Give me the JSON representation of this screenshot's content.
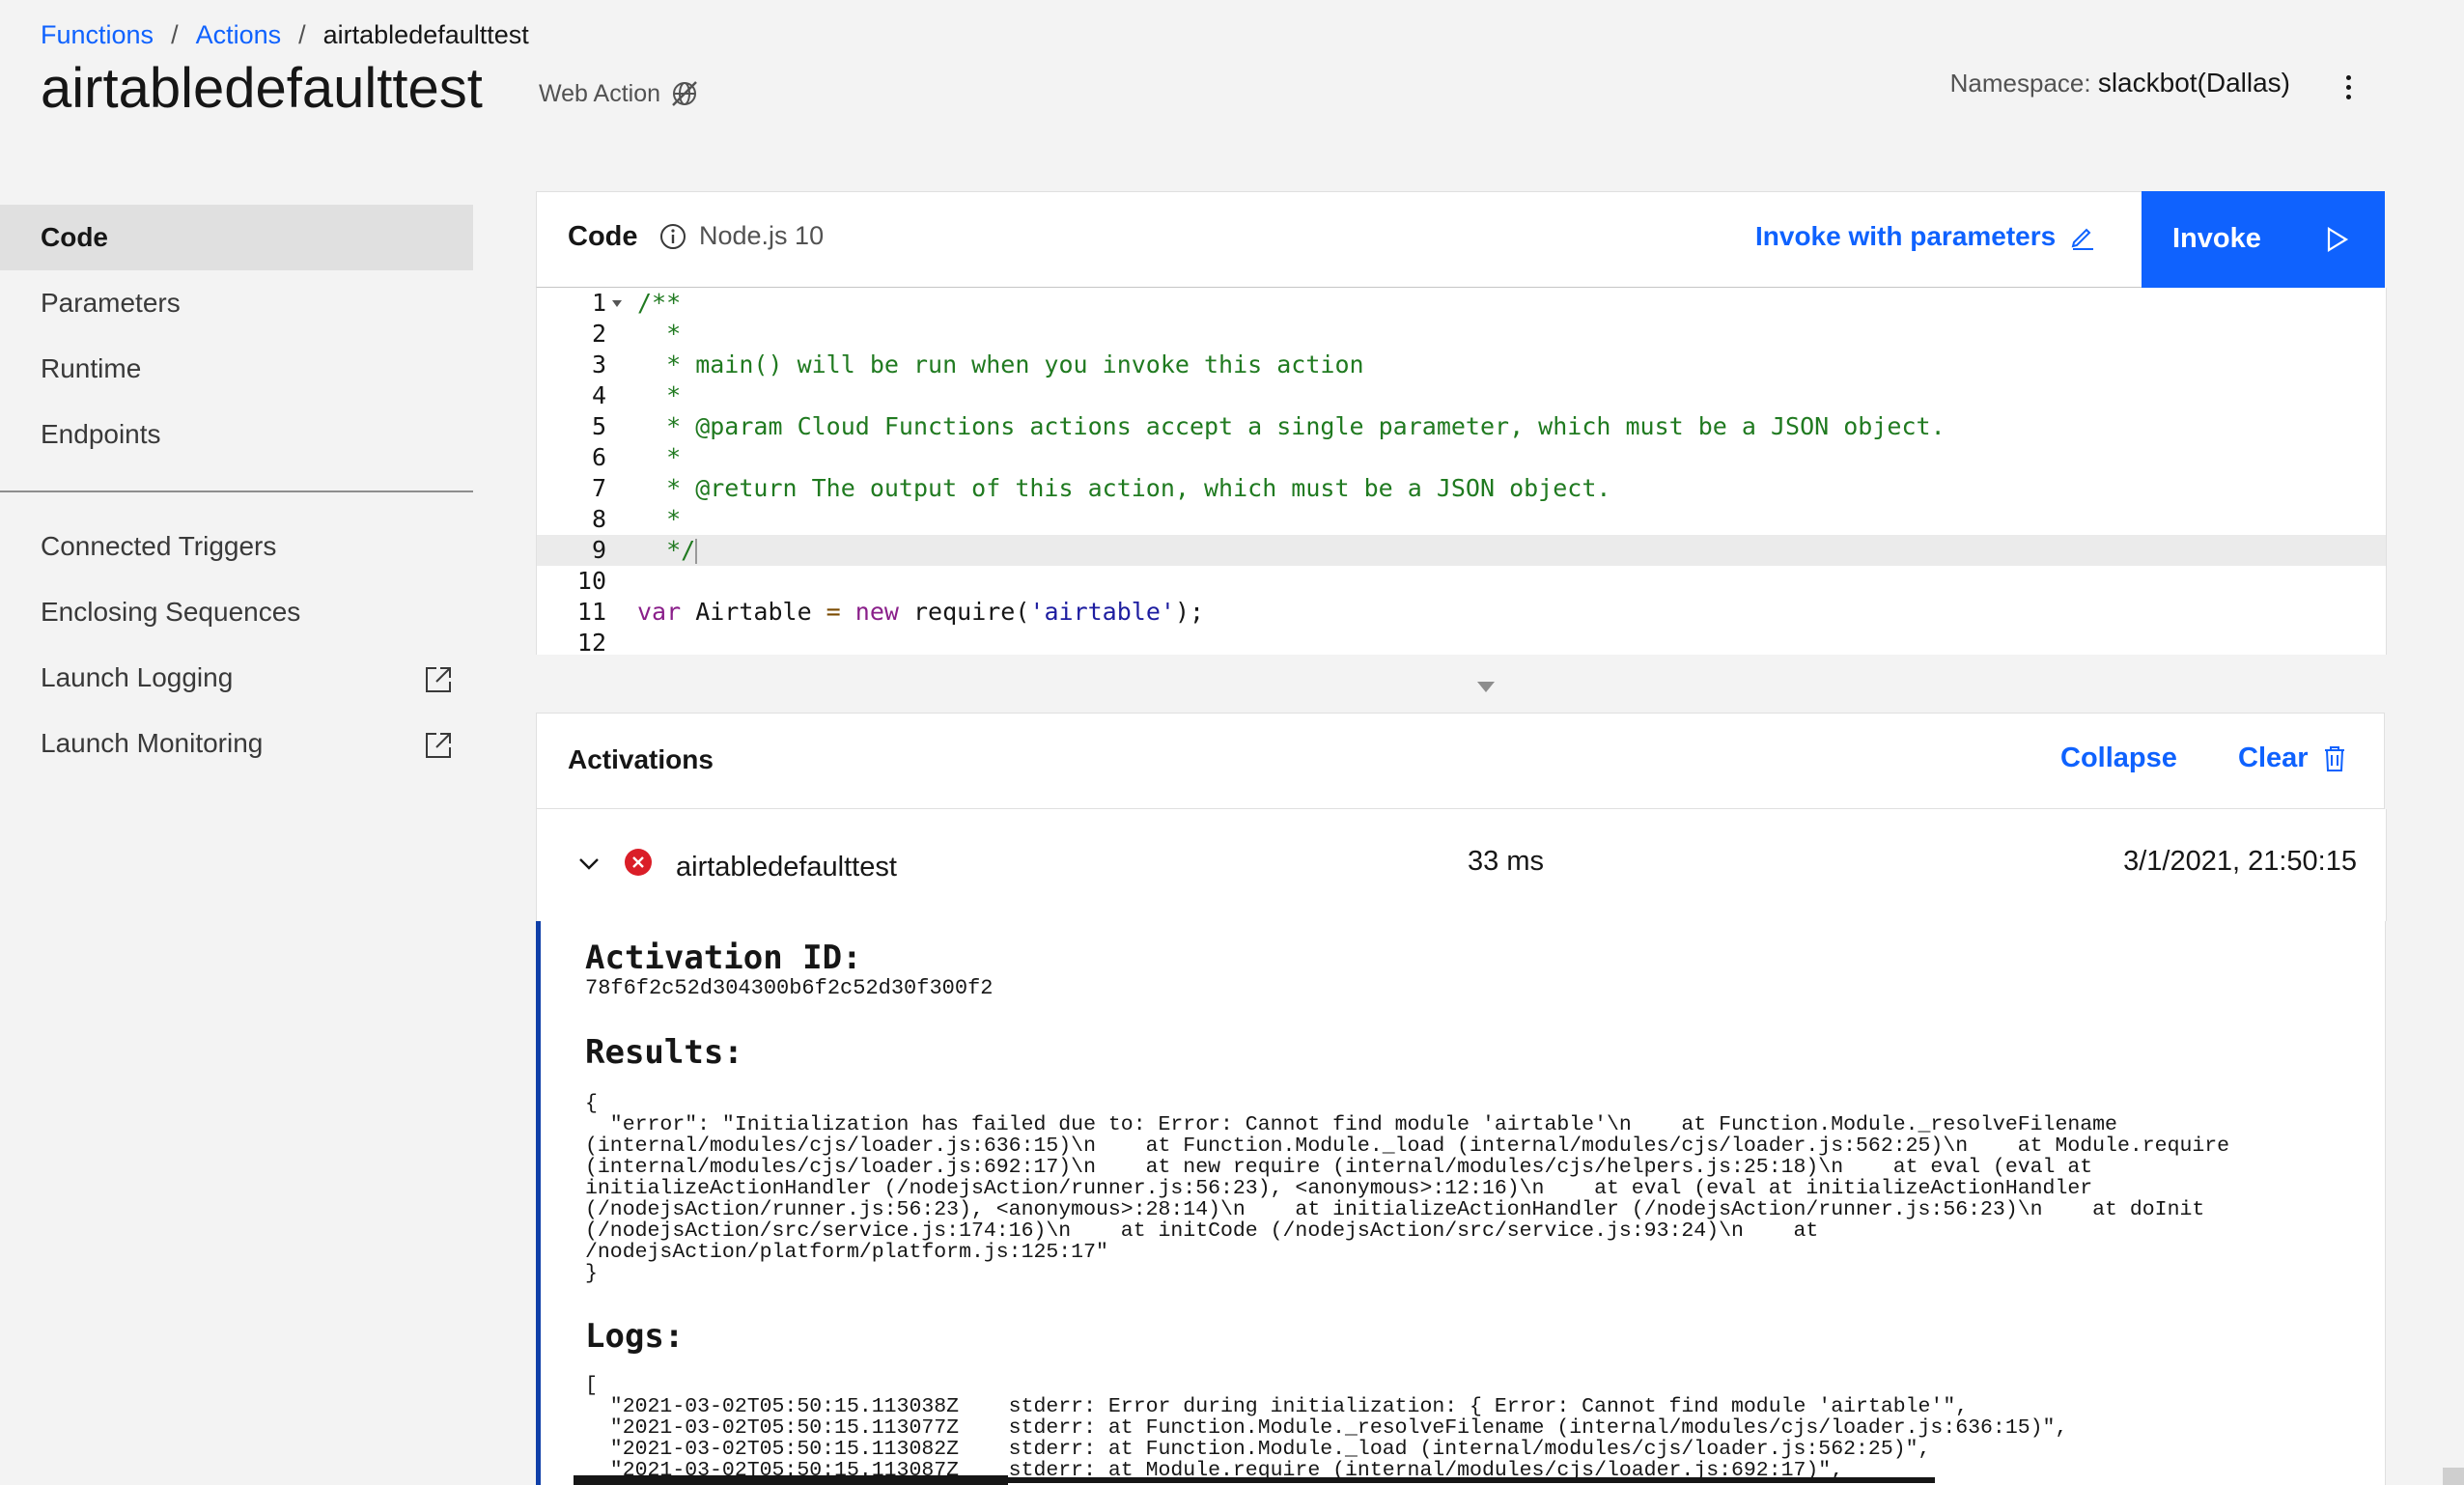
{
  "breadcrumb": {
    "functions": "Functions",
    "actions": "Actions",
    "current": "airtabledefaulttest"
  },
  "page_title": "airtabledefaulttest",
  "web_action_label": "Web Action",
  "namespace": {
    "label": "Namespace:",
    "value": "slackbot(Dallas)"
  },
  "sidebar": {
    "items": [
      {
        "label": "Code"
      },
      {
        "label": "Parameters"
      },
      {
        "label": "Runtime"
      },
      {
        "label": "Endpoints"
      },
      {
        "label": "Connected Triggers"
      },
      {
        "label": "Enclosing Sequences"
      },
      {
        "label": "Launch Logging"
      },
      {
        "label": "Launch Monitoring"
      }
    ]
  },
  "code_panel": {
    "title": "Code",
    "runtime": "Node.js 10",
    "invoke_with_params": "Invoke with parameters",
    "invoke": "Invoke"
  },
  "editor": {
    "lines": [
      {
        "n": "1",
        "text": "/**"
      },
      {
        "n": "2",
        "text": "  *"
      },
      {
        "n": "3",
        "text": "  * main() will be run when you invoke this action"
      },
      {
        "n": "4",
        "text": "  *"
      },
      {
        "n": "5",
        "text": "  * @param Cloud Functions actions accept a single parameter, which must be a JSON object."
      },
      {
        "n": "6",
        "text": "  *"
      },
      {
        "n": "7",
        "text": "  * @return The output of this action, which must be a JSON object."
      },
      {
        "n": "8",
        "text": "  *"
      },
      {
        "n": "9",
        "text": "  */"
      },
      {
        "n": "10",
        "text": ""
      },
      {
        "n": "11",
        "text": "var Airtable = new require('airtable');"
      },
      {
        "n": "12",
        "text": ""
      }
    ],
    "line11": {
      "kw_var": "var",
      "ident": " Airtable ",
      "eq": "=",
      "kw_new": " new",
      "call": " require(",
      "str": "'airtable'",
      "end": ");"
    }
  },
  "activations": {
    "title": "Activations",
    "collapse": "Collapse",
    "clear": "Clear",
    "row": {
      "name": "airtabledefaulttest",
      "duration": "33 ms",
      "date": "3/1/2021, 21:50:15",
      "status": "error"
    },
    "detail": {
      "id_heading": "Activation ID:",
      "id_value": "78f6f2c52d304300b6f2c52d30f300f2",
      "results_heading": "Results:",
      "results_text": "{\n  \"error\": \"Initialization has failed due to: Error: Cannot find module 'airtable'\\n    at Function.Module._resolveFilename\n(internal/modules/cjs/loader.js:636:15)\\n    at Function.Module._load (internal/modules/cjs/loader.js:562:25)\\n    at Module.require\n(internal/modules/cjs/loader.js:692:17)\\n    at new require (internal/modules/cjs/helpers.js:25:18)\\n    at eval (eval at\ninitializeActionHandler (/nodejsAction/runner.js:56:23), <anonymous>:12:16)\\n    at eval (eval at initializeActionHandler\n(/nodejsAction/runner.js:56:23), <anonymous>:28:14)\\n    at initializeActionHandler (/nodejsAction/runner.js:56:23)\\n    at doInit\n(/nodejsAction/src/service.js:174:16)\\n    at initCode (/nodejsAction/src/service.js:93:24)\\n    at\n/nodejsAction/platform/platform.js:125:17\"\n}",
      "logs_heading": "Logs:",
      "logs_text": "[\n  \"2021-03-02T05:50:15.113038Z    stderr: Error during initialization: { Error: Cannot find module 'airtable'\",\n  \"2021-03-02T05:50:15.113077Z    stderr: at Function.Module._resolveFilename (internal/modules/cjs/loader.js:636:15)\",\n  \"2021-03-02T05:50:15.113082Z    stderr: at Function.Module._load (internal/modules/cjs/loader.js:562:25)\",\n  \"2021-03-02T05:50:15.113087Z    stderr: at Module.require (internal/modules/cjs/loader.js:692:17)\","
    }
  },
  "colors": {
    "accent": "#0f62fe",
    "error": "#da1e28",
    "comment": "#207a20"
  }
}
